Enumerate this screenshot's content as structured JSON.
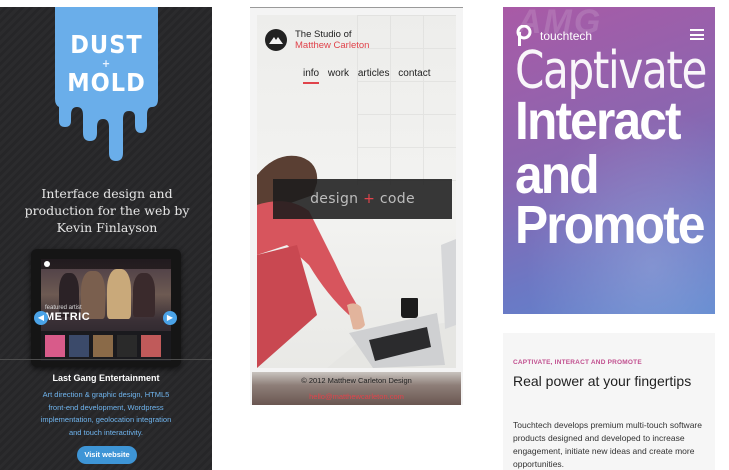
{
  "panel1": {
    "logo": {
      "line1": "DUST",
      "plus": "+",
      "line2": "MOLD"
    },
    "tagline": "Interface design and production for the web by Kevin Finlayson",
    "device_screen": {
      "featured_label": "featured artist",
      "artist_name": "METRIC"
    },
    "project": {
      "title": "Last Gang Entertainment",
      "description": "Art direction & graphic design, HTML5 front-end development, Wordpress implementation, geolocation integration and touch interactivity.",
      "button_label": "Visit website"
    },
    "colors": {
      "accent_blue": "#6aaeea",
      "background": "#2a2a2c"
    }
  },
  "panel2": {
    "logo": {
      "line1": "The Studio of",
      "line2": "Matthew Carleton"
    },
    "nav": [
      {
        "label": "info",
        "active": true
      },
      {
        "label": "work",
        "active": false
      },
      {
        "label": "articles",
        "active": false
      },
      {
        "label": "contact",
        "active": false
      }
    ],
    "banner": {
      "word1": "design",
      "plus": "+",
      "word2": "code"
    },
    "copyright": "© 2012 Matthew Carleton Design",
    "email": "hello@matthewcarleton.com",
    "colors": {
      "accent_red": "#e0434b"
    }
  },
  "panel3": {
    "brand": "touchtech",
    "bg_sign": "AMG",
    "hero": {
      "line1": "Captivate",
      "line2": "Interact",
      "line3": "and",
      "line4": "Promote"
    },
    "card": {
      "kicker": "CAPTIVATE, INTERACT AND PROMOTE",
      "headline": "Real power at your fingertips",
      "body": "Touchtech develops premium multi-touch software products designed and developed to increase engagement, initiate new ideas and create more opportunities."
    },
    "colors": {
      "gradient_start": "#a95aa6",
      "gradient_end": "#5d86cf",
      "kicker": "#c14f8f"
    }
  }
}
